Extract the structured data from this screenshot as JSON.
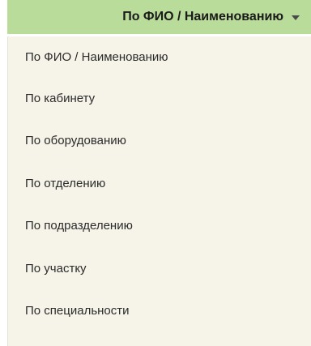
{
  "dropdown": {
    "selected_label": "По ФИО / Наименованию",
    "caret_icon": "caret-down-icon",
    "button_color": "#b9dc9a",
    "menu_color": "#f6f3e8"
  },
  "menu": {
    "items": [
      {
        "label": "По ФИО / Наименованию"
      },
      {
        "label": "По кабинету"
      },
      {
        "label": "По оборудованию"
      },
      {
        "label": "По отделению"
      },
      {
        "label": "По подразделению"
      },
      {
        "label": "По участку"
      },
      {
        "label": "По специальности"
      }
    ]
  }
}
